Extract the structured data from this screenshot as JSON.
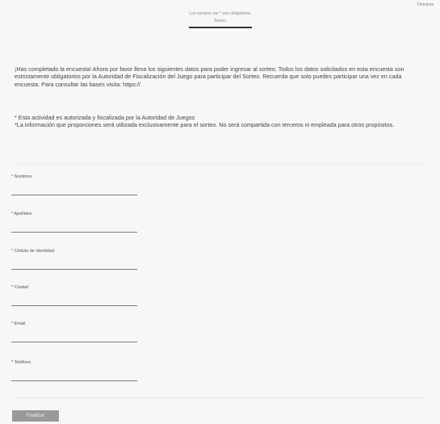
{
  "top_link": "Términos",
  "header": {
    "subtitle": "Los campos con * son obligatorios",
    "answers": "Sorteo"
  },
  "intro": "¡Has completado la encuesta! Ahora por favor llena los siguientes datos para poder ingresar al sorteo. Todos los datos solicitados en esta encuesta son estrictamente obligatorios por la Autoridad de Fiscalización del Juego para participar del Sorteo. Recuerda que solo puedes participar una vez en cada encuesta. Para consultar las bases visita: https://",
  "notes": [
    "* Esta actividad es autorizada y fiscalizada por la Autoridad de Juegos",
    "*La información que proporciones será utilizada exclusivamente para el sorteo. No será compartida con terceros ni empleada para otros propósitos."
  ],
  "fields": [
    {
      "label": "* Nombres",
      "placeholder": "",
      "value": ""
    },
    {
      "label": "* Apellidos",
      "placeholder": "",
      "value": ""
    },
    {
      "label": "* Cédula de Identidad",
      "placeholder": "",
      "value": ""
    },
    {
      "label": "* Ciudad",
      "placeholder": "",
      "value": ""
    },
    {
      "label": "* Email",
      "placeholder": "",
      "value": ""
    },
    {
      "label": "* Teléfono",
      "placeholder": "",
      "value": ""
    }
  ],
  "submit_label": "Finalizar"
}
